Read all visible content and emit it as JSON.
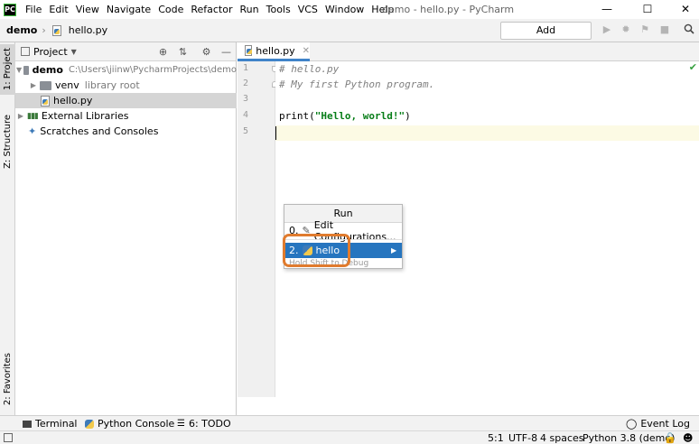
{
  "app": {
    "window_title": "demo - hello.py - PyCharm",
    "menu": [
      "File",
      "Edit",
      "View",
      "Navigate",
      "Code",
      "Refactor",
      "Run",
      "Tools",
      "VCS",
      "Window",
      "Help"
    ]
  },
  "navbar": {
    "breadcrumb_root": "demo",
    "breadcrumb_file": "hello.py",
    "add_configuration_label": "Add Configuration..."
  },
  "side_tabs": {
    "project": "1: Project",
    "structure": "Z: Structure",
    "favorites": "2: Favorites"
  },
  "project_panel": {
    "title": "Project",
    "tree": {
      "root_name": "demo",
      "root_path": "C:\\Users\\jiinw\\PycharmProjects\\demo",
      "venv_name": "venv",
      "venv_note": "library root",
      "file_name": "hello.py",
      "external_libraries": "External Libraries",
      "scratches": "Scratches and Consoles"
    }
  },
  "editor": {
    "tab_label": "hello.py",
    "line_numbers": [
      "1",
      "2",
      "3",
      "4",
      "5"
    ],
    "lines": {
      "l1": "# hello.py",
      "l2": "# My first Python program.",
      "l4_func": "print(",
      "l4_str": "\"Hello, world!\"",
      "l4_end": ")"
    }
  },
  "run_popup": {
    "title": "Run",
    "items": [
      {
        "prefix": "0.",
        "label": "Edit Configurations..."
      },
      {
        "prefix": "2.",
        "label": "hello"
      }
    ],
    "hint": "Hold Shift to Debug"
  },
  "bottom_tools": {
    "terminal": "Terminal",
    "python_console": "Python Console",
    "todo": "6: TODO",
    "event_log": "Event Log"
  },
  "status_bar": {
    "position": "5:1",
    "encoding": "UTF-8",
    "indent": "4 spaces",
    "interpreter": "Python 3.8 (demo)"
  },
  "colors": {
    "selection_blue": "#2675bf",
    "annotation_orange": "#e07b2e",
    "string_green": "#067d17",
    "current_line": "#fcfae4"
  }
}
